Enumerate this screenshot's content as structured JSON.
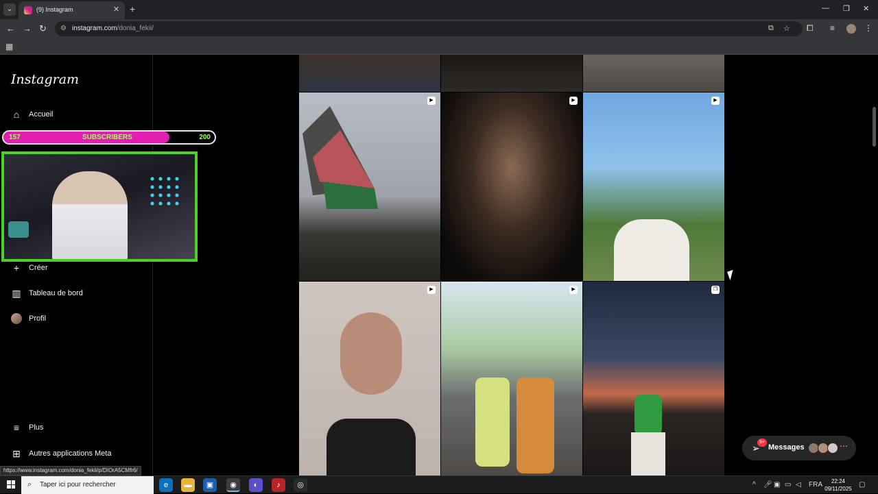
{
  "browser": {
    "tab_title": "(9) Instagram",
    "url_host": "instagram.com",
    "url_path": "/donia_fekii/",
    "status_url": "https://www.instagram.com/donia_fekii/p/DIOrA5CMfr6/"
  },
  "instagram": {
    "logo": "Instagram",
    "nav": [
      {
        "label": "Accueil",
        "icon": "home-icon"
      },
      {
        "label": "Créer",
        "icon": "plus-icon"
      },
      {
        "label": "Tableau de bord",
        "icon": "chart-icon"
      },
      {
        "label": "Profil",
        "icon": "avatar"
      },
      {
        "label": "Plus",
        "icon": "menu-icon"
      },
      {
        "label": "Autres applications Meta",
        "icon": "meta-apps-icon"
      }
    ],
    "messages": {
      "label": "Messages",
      "badge": "9+"
    }
  },
  "overlay": {
    "sub_current": "157",
    "sub_label": "SUBSCRIBERS",
    "sub_goal": "200",
    "sub_progress_fraction": 0.785
  },
  "taskbar": {
    "search_placeholder": "Taper ici pour rechercher",
    "language": "FRA",
    "time": "22:24",
    "date": "09/11/2025"
  },
  "colors": {
    "accent_pink": "#e11fb2",
    "accent_green": "#4bd128",
    "notification_red": "#ff3040"
  }
}
